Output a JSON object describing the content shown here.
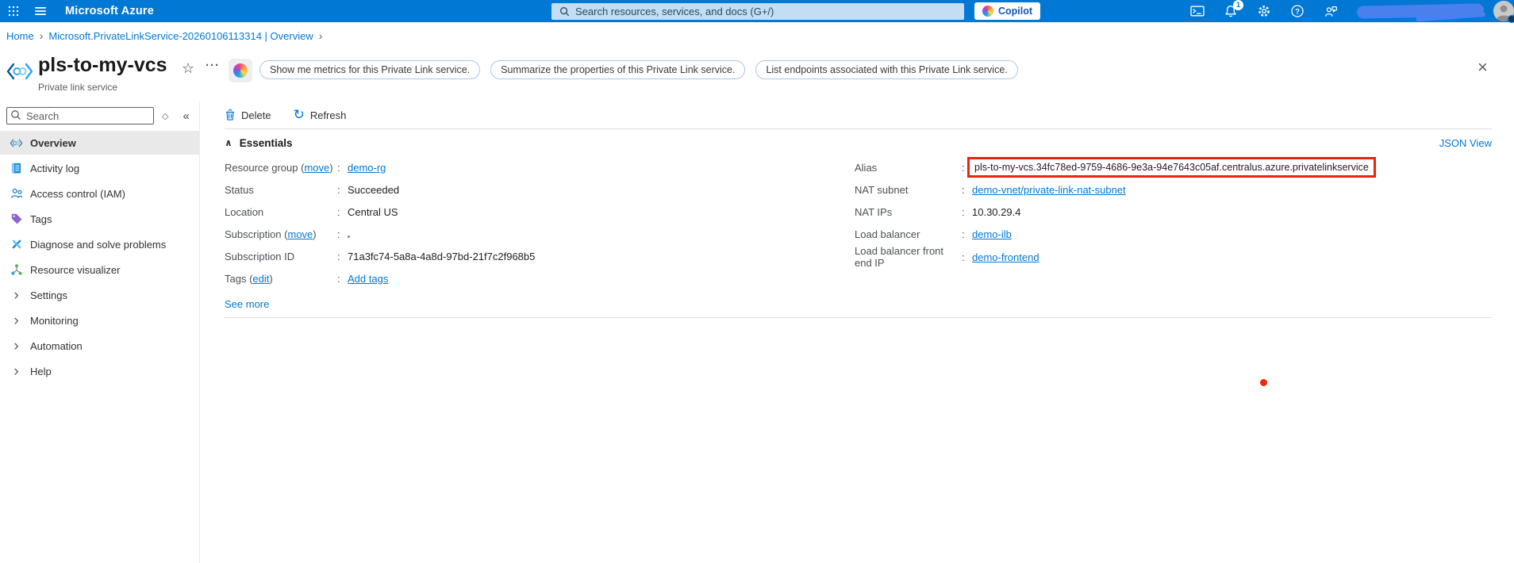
{
  "colors": {
    "topbar_blue": "#0078d4",
    "link_blue": "#0078d4",
    "highlight_red": "#e8240f",
    "tag_purple": "#8f63cc"
  },
  "icons": {
    "star": "☆",
    "more": "···",
    "close": "×",
    "collapse_menu": "«",
    "sort": "◇",
    "chevron_right": "›",
    "section_caret": "∧",
    "refresh_glyph": "↻",
    "breadcrumb_sep": "›"
  },
  "topbar": {
    "brand": "Microsoft Azure",
    "search_placeholder": "Search resources, services, and docs (G+/)",
    "copilot_label": "Copilot",
    "notification_count": "1"
  },
  "breadcrumb": {
    "items": [
      "Home",
      "Microsoft.PrivateLinkService-20260106113314 | Overview"
    ]
  },
  "header": {
    "title": "pls-to-my-vcs",
    "subtitle": "Private link service",
    "chips": [
      "Show me metrics for this Private Link service.",
      "Summarize the properties of this Private Link service.",
      "List endpoints associated with this Private Link service."
    ]
  },
  "sidebar": {
    "search_placeholder": "Search",
    "items": [
      {
        "label": "Overview"
      },
      {
        "label": "Activity log"
      },
      {
        "label": "Access control (IAM)"
      },
      {
        "label": "Tags"
      },
      {
        "label": "Diagnose and solve problems"
      },
      {
        "label": "Resource visualizer"
      },
      {
        "label": "Settings"
      },
      {
        "label": "Monitoring"
      },
      {
        "label": "Automation"
      },
      {
        "label": "Help"
      }
    ]
  },
  "toolbar": {
    "delete": "Delete",
    "refresh": "Refresh"
  },
  "essentials": {
    "heading": "Essentials",
    "json_view": "JSON View",
    "see_more": "See more",
    "left": [
      {
        "label_pre": "Resource group (",
        "label_link": "move",
        "label_post": ")",
        "value": "demo-rg"
      },
      {
        "label": "Status",
        "value": "Succeeded"
      },
      {
        "label": "Location",
        "value": "Central US"
      },
      {
        "label_pre": "Subscription (",
        "label_link": "move",
        "label_post": ")",
        "value": ""
      },
      {
        "label": "Subscription ID",
        "value": "71a3fc74-5a8a-4a8d-97bd-21f7c2f968b5"
      },
      {
        "label_pre": "Tags (",
        "label_link": "edit",
        "label_post": ")",
        "value": "Add tags"
      }
    ],
    "right": [
      {
        "label": "Alias",
        "value": "pls-to-my-vcs.34fc78ed-9759-4686-9e3a-94e7643c05af.centralus.azure.privatelinkservice"
      },
      {
        "label": "NAT subnet",
        "value": "demo-vnet/private-link-nat-subnet"
      },
      {
        "label": "NAT IPs",
        "value": "10.30.29.4"
      },
      {
        "label": "Load balancer",
        "value": "demo-ilb"
      },
      {
        "label": "Load balancer front end IP",
        "value": "demo-frontend"
      }
    ]
  }
}
